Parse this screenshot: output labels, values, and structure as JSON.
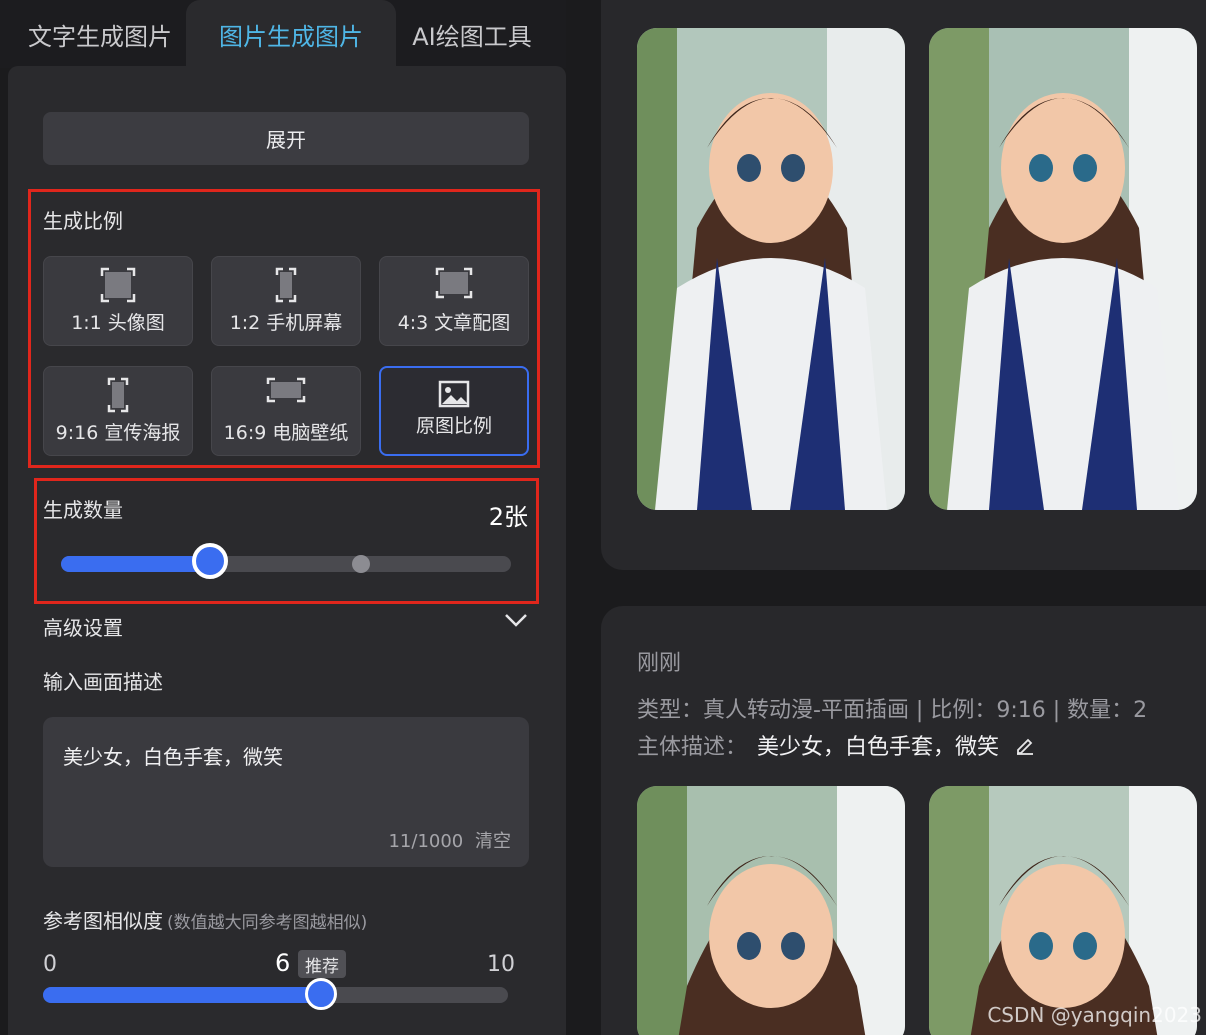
{
  "tabs": [
    {
      "label": "文字生成图片"
    },
    {
      "label": "图片生成图片"
    },
    {
      "label": "AI绘图工具"
    }
  ],
  "expand_button": "展开",
  "ratio_section": {
    "label": "生成比例",
    "options": [
      {
        "label": "1:1 头像图",
        "icon": "square-frame-icon",
        "selected": false
      },
      {
        "label": "1:2 手机屏幕",
        "icon": "phone-frame-icon",
        "selected": false
      },
      {
        "label": "4:3 文章配图",
        "icon": "landscape-frame-icon",
        "selected": false
      },
      {
        "label": "9:16 宣传海报",
        "icon": "portrait-frame-icon",
        "selected": false
      },
      {
        "label": "16:9 电脑壁纸",
        "icon": "widescreen-frame-icon",
        "selected": false
      },
      {
        "label": "原图比例",
        "icon": "image-icon",
        "selected": true
      }
    ]
  },
  "quantity_section": {
    "label": "生成数量",
    "value": "2张",
    "level_fraction": 0.33
  },
  "advanced": {
    "label": "高级设置"
  },
  "description": {
    "label": "输入画面描述",
    "text": "美少女，白色手套，微笑",
    "counter": "11/1000",
    "clear": "清空"
  },
  "similarity": {
    "label": "参考图相似度",
    "hint": "(数值越大同参考图越相似)",
    "min": "0",
    "max": "10",
    "current": "6",
    "badge": "推荐",
    "level_fraction": 0.6
  },
  "result_card": {
    "time": "刚刚",
    "meta": "类型：真人转动漫-平面插画 | 比例：9:16 | 数量：2",
    "subject_label": "主体描述：",
    "subject_value": "美少女，白色手套，微笑"
  },
  "watermark": "CSDN @yangqin2023",
  "colors": {
    "accent": "#3a6df0",
    "tab_active": "#4fb6e6",
    "highlight_border": "#e0261c",
    "panel_bg": "#2a2a2d"
  }
}
